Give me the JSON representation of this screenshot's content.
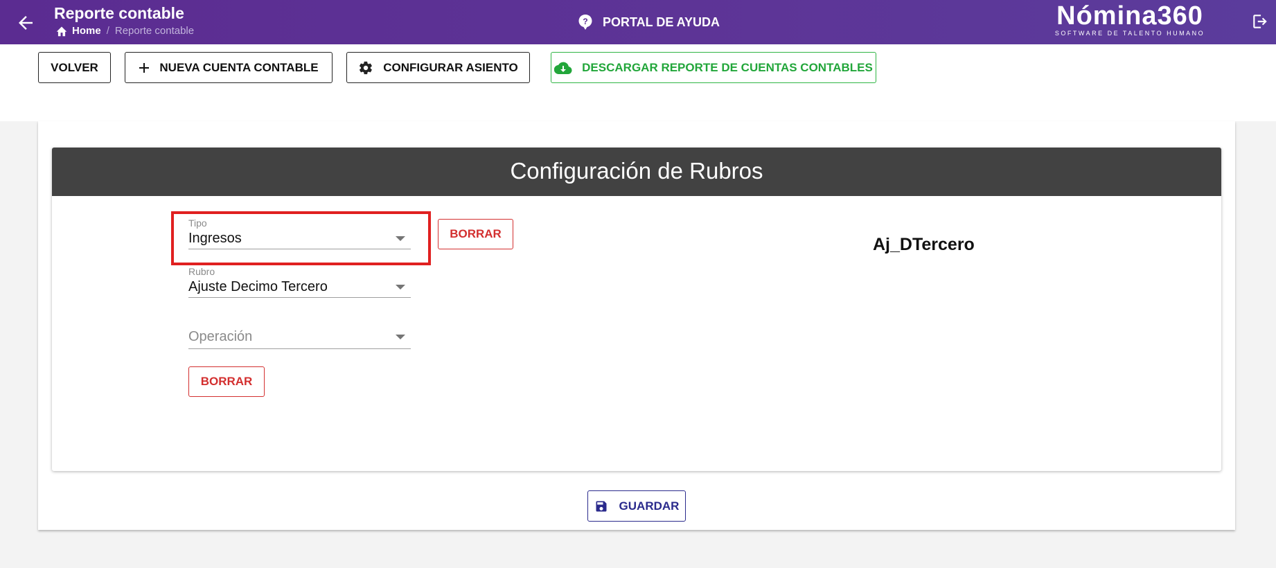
{
  "header": {
    "title": "Reporte contable",
    "breadcrumb": {
      "home": "Home",
      "separator": "/",
      "current": "Reporte contable"
    },
    "help_label": "PORTAL DE AYUDA",
    "logo": {
      "name": "Nómina360",
      "tagline": "SOFTWARE DE TALENTO HUMANO"
    },
    "colors": {
      "bar": "#5b2c91",
      "text": "#ffffff"
    }
  },
  "toolbar": {
    "back_label": "VOLVER",
    "new_account_label": "NUEVA CUENTA CONTABLE",
    "configure_label": "CONFIGURAR ASIENTO",
    "download_label": "DESCARGAR REPORTE DE CUENTAS CONTABLES"
  },
  "form": {
    "section_title": "Configuración de Rubros",
    "tipo": {
      "label": "Tipo",
      "value": "Ingresos"
    },
    "rubro": {
      "label": "Rubro",
      "value": "Ajuste Decimo Tercero"
    },
    "operacion": {
      "placeholder": "Operación",
      "value": ""
    },
    "clear_label_1": "BORRAR",
    "clear_label_2": "BORRAR",
    "code": "Aj_DTercero",
    "save_label": "GUARDAR"
  },
  "colors": {
    "danger": "#d32f2f",
    "success": "#22a63a",
    "primary": "#2a2a8c",
    "highlight": "#e02020"
  }
}
